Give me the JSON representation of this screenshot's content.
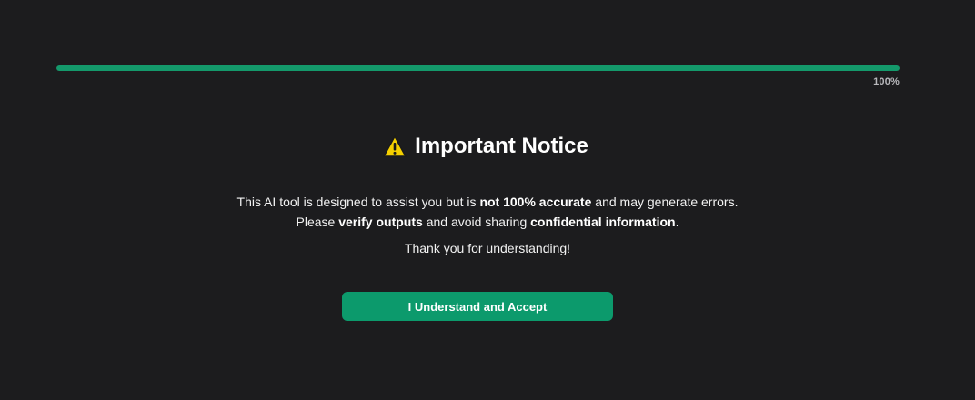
{
  "progress": {
    "value": 1.0,
    "label": "100%",
    "color": "#14996b"
  },
  "notice": {
    "icon": "warning-icon",
    "title": "Important Notice",
    "line1": {
      "part1": "This AI tool is designed to assist you but is ",
      "bold1": "not 100% accurate",
      "part2": " and may generate errors."
    },
    "line2": {
      "part1": "Please ",
      "bold1": "verify outputs",
      "part2": " and avoid sharing ",
      "bold2": "confidential information",
      "part3": "."
    },
    "thanks": "Thank you for understanding!"
  },
  "actions": {
    "accept_label": "I Understand and Accept",
    "accept_color": "#0c9a6c"
  },
  "colors": {
    "background": "#1c1c1e",
    "text": "#ffffff",
    "warning_yellow": "#f5d000"
  }
}
